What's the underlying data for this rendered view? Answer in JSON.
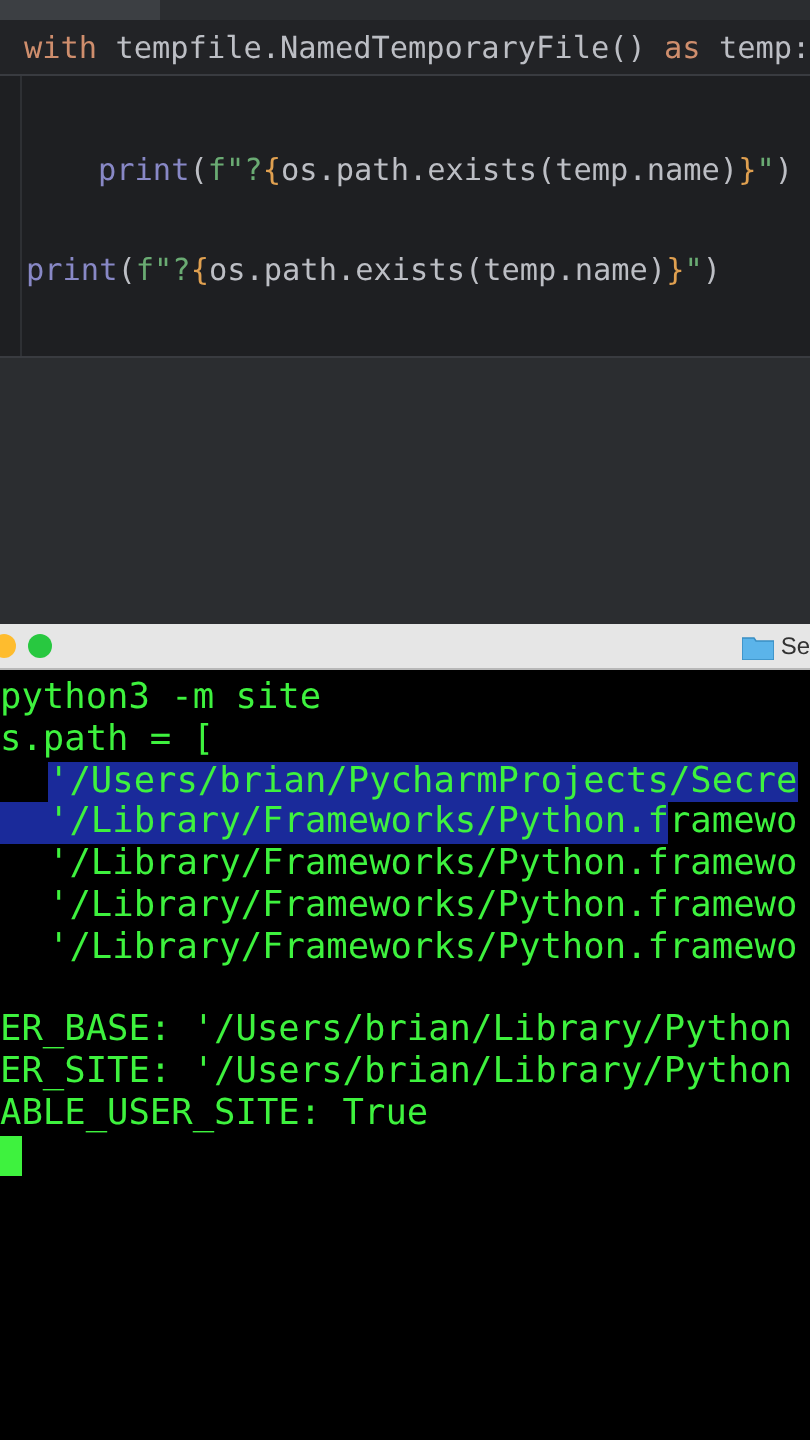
{
  "editor": {
    "sticky_header": {
      "tokens": [
        {
          "kind": "keyword",
          "text": "with"
        },
        {
          "kind": "plain",
          "text": " tempfile.NamedTemporaryFile() "
        },
        {
          "kind": "keyword",
          "text": "as"
        },
        {
          "kind": "plain",
          "text": " temp:"
        }
      ]
    },
    "lines": [
      {
        "kind": "indented",
        "tokens": [
          {
            "kind": "builtin",
            "text": "print"
          },
          {
            "kind": "plain",
            "text": "("
          },
          {
            "kind": "string",
            "text": "f\"?"
          },
          {
            "kind": "brace",
            "text": "{"
          },
          {
            "kind": "plain",
            "text": "os.path.exists(temp.name)"
          },
          {
            "kind": "brace",
            "text": "}"
          },
          {
            "kind": "string",
            "text": "\""
          },
          {
            "kind": "plain",
            "text": ")"
          }
        ]
      },
      {
        "kind": "top",
        "tokens": [
          {
            "kind": "builtin",
            "text": "print"
          },
          {
            "kind": "plain",
            "text": "("
          },
          {
            "kind": "string",
            "text": "f\"?"
          },
          {
            "kind": "brace",
            "text": "{"
          },
          {
            "kind": "plain",
            "text": "os.path.exists(temp.name)"
          },
          {
            "kind": "brace",
            "text": "}"
          },
          {
            "kind": "string",
            "text": "\""
          },
          {
            "kind": "plain",
            "text": ")"
          }
        ]
      }
    ]
  },
  "terminal": {
    "title": "Se",
    "lines": [
      {
        "kind": "text",
        "segments": [
          {
            "text": "python3 -m site",
            "selected": false
          }
        ]
      },
      {
        "kind": "text",
        "segments": [
          {
            "text": "s.path = [",
            "selected": false
          }
        ]
      },
      {
        "kind": "indented",
        "indent_selected": false,
        "segments": [
          {
            "text": "'/Users/brian/PycharmProjects/Secre",
            "selected": true
          }
        ]
      },
      {
        "kind": "indented",
        "indent_selected": true,
        "segments": [
          {
            "text": "'/Library/Frameworks/Python.f",
            "selected": true
          },
          {
            "text": "ramewo",
            "selected": false
          }
        ]
      },
      {
        "kind": "indented",
        "indent_selected": false,
        "segments": [
          {
            "text": "'/Library/Frameworks/Python.framewo",
            "selected": false
          }
        ]
      },
      {
        "kind": "indented",
        "indent_selected": false,
        "segments": [
          {
            "text": "'/Library/Frameworks/Python.framewo",
            "selected": false
          }
        ]
      },
      {
        "kind": "indented",
        "indent_selected": false,
        "segments": [
          {
            "text": "'/Library/Frameworks/Python.framewo",
            "selected": false
          }
        ]
      },
      {
        "kind": "blank"
      },
      {
        "kind": "text",
        "segments": [
          {
            "text": "ER_BASE: '/Users/brian/Library/Python",
            "selected": false
          }
        ]
      },
      {
        "kind": "text",
        "segments": [
          {
            "text": "ER_SITE: '/Users/brian/Library/Python",
            "selected": false
          }
        ]
      },
      {
        "kind": "text",
        "segments": [
          {
            "text": "ABLE_USER_SITE: True",
            "selected": false
          }
        ]
      }
    ]
  }
}
